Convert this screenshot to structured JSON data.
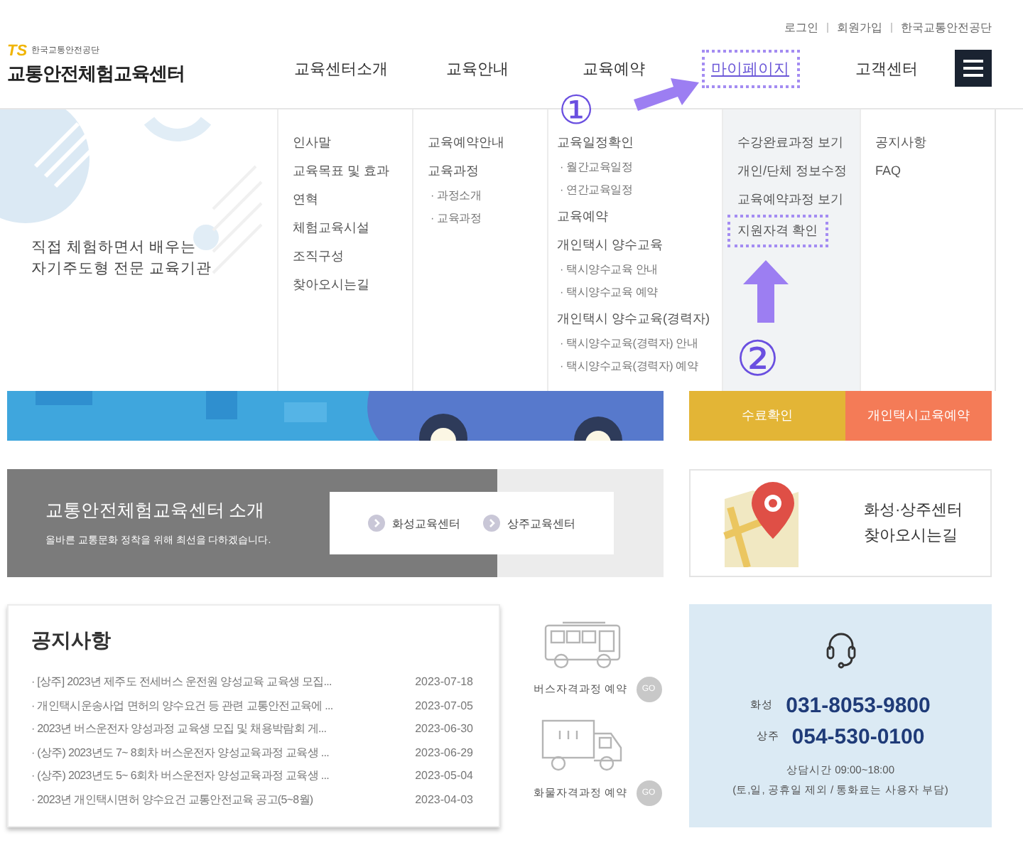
{
  "top_links": [
    "로그인",
    "회원가입",
    "한국교통안전공단"
  ],
  "logo": {
    "badge": "TS",
    "org": "한국교통안전공단",
    "title": "교통안전체험교육센터"
  },
  "nav": [
    {
      "label": "교육센터소개",
      "highlighted": false
    },
    {
      "label": "교육안내",
      "highlighted": false
    },
    {
      "label": "교육예약",
      "highlighted": false
    },
    {
      "label": "마이페이지",
      "highlighted": true
    },
    {
      "label": "고객센터",
      "highlighted": false
    }
  ],
  "mega_menu": {
    "tagline": [
      "직접 체험하면서 배우는",
      "자기주도형 전문 교육기관"
    ],
    "columns": [
      {
        "selected": false,
        "items": [
          {
            "label": "인사말",
            "kind": "main",
            "highlighted": false
          },
          {
            "label": "교육목표 및 효과",
            "kind": "main",
            "highlighted": false
          },
          {
            "label": "연혁",
            "kind": "main",
            "highlighted": false
          },
          {
            "label": "체험교육시설",
            "kind": "main",
            "highlighted": false
          },
          {
            "label": "조직구성",
            "kind": "main",
            "highlighted": false
          },
          {
            "label": "찾아오시는길",
            "kind": "main",
            "highlighted": false
          }
        ]
      },
      {
        "selected": false,
        "items": [
          {
            "label": "교육예약안내",
            "kind": "main",
            "highlighted": false
          },
          {
            "label": "교육과정",
            "kind": "main",
            "highlighted": false
          },
          {
            "label": "· 과정소개",
            "kind": "sub",
            "highlighted": false
          },
          {
            "label": "· 교육과정",
            "kind": "sub",
            "highlighted": false
          }
        ]
      },
      {
        "selected": false,
        "items": [
          {
            "label": "교육일정확인",
            "kind": "main",
            "highlighted": false
          },
          {
            "label": "· 월간교육일정",
            "kind": "sub",
            "highlighted": false
          },
          {
            "label": "· 연간교육일정",
            "kind": "sub",
            "highlighted": false
          },
          {
            "label": "교육예약",
            "kind": "main",
            "highlighted": false
          },
          {
            "label": "개인택시 양수교육",
            "kind": "main",
            "highlighted": false
          },
          {
            "label": "· 택시양수교육 안내",
            "kind": "sub",
            "highlighted": false
          },
          {
            "label": "· 택시양수교육 예약",
            "kind": "sub",
            "highlighted": false
          },
          {
            "label": "개인택시 양수교육(경력자)",
            "kind": "main",
            "highlighted": false
          },
          {
            "label": "· 택시양수교육(경력자) 안내",
            "kind": "sub",
            "highlighted": false
          },
          {
            "label": "· 택시양수교육(경력자) 예약",
            "kind": "sub",
            "highlighted": false
          }
        ]
      },
      {
        "selected": true,
        "items": [
          {
            "label": "수강완료과정 보기",
            "kind": "main",
            "highlighted": false
          },
          {
            "label": "개인/단체 정보수정",
            "kind": "main",
            "highlighted": false
          },
          {
            "label": "교육예약과정 보기",
            "kind": "main",
            "highlighted": false
          },
          {
            "label": "지원자격 확인",
            "kind": "main",
            "highlighted": true
          }
        ]
      },
      {
        "selected": false,
        "items": [
          {
            "label": "공지사항",
            "kind": "main",
            "highlighted": false
          },
          {
            "label": "FAQ",
            "kind": "main",
            "highlighted": false
          }
        ]
      }
    ]
  },
  "quick_buttons": [
    {
      "label": "수료확인",
      "color": "#e3b536"
    },
    {
      "label": "개인택시교육예약",
      "color": "#f47b57"
    }
  ],
  "intro": {
    "title": "교통안전체험교육센터 소개",
    "subtitle": "올바른 교통문화 정착을 위해 최선을 다하겠습니다.",
    "links": [
      "화성교육센터",
      "상주교육센터"
    ]
  },
  "location_card": {
    "lines": [
      "화성·상주센터",
      "찾아오시는길"
    ]
  },
  "notices": {
    "title": "공지사항",
    "items": [
      {
        "title": "· [상주] 2023년 제주도 전세버스 운전원 양성교육 교육생 모집...",
        "date": "2023-07-18"
      },
      {
        "title": "· 개인택시운송사업 면허의 양수요건 등 관련 교통안전교육에 ...",
        "date": "2023-07-05"
      },
      {
        "title": "· 2023년 버스운전자 양성과정 교육생 모집 및 채용박람회 게...",
        "date": "2023-06-30"
      },
      {
        "title": "· (상주) 2023년도 7~ 8회차 버스운전자 양성교육과정 교육생 ...",
        "date": "2023-06-29"
      },
      {
        "title": "· (상주) 2023년도 5~ 6회차 버스운전자 양성교육과정 교육생 ...",
        "date": "2023-05-04"
      },
      {
        "title": "· 2023년 개인택시면허 양수요건 교통안전교육 공고(5~8월)",
        "date": "2023-04-03"
      }
    ]
  },
  "course_links": [
    {
      "kind": "bus",
      "label": "버스자격과정 예약",
      "button": "GO"
    },
    {
      "kind": "truck",
      "label": "화물자격과정 예약",
      "button": "GO"
    }
  ],
  "contact": {
    "lines": [
      {
        "center": "화성",
        "phone": "031-8053-9800"
      },
      {
        "center": "상주",
        "phone": "054-530-0100"
      }
    ],
    "hours": "상담시간 09:00~18:00",
    "note": "(토,일, 공휴일 제외 / 통화료는 사용자 부담)"
  },
  "annotations": {
    "markers": [
      "①",
      "②"
    ]
  }
}
